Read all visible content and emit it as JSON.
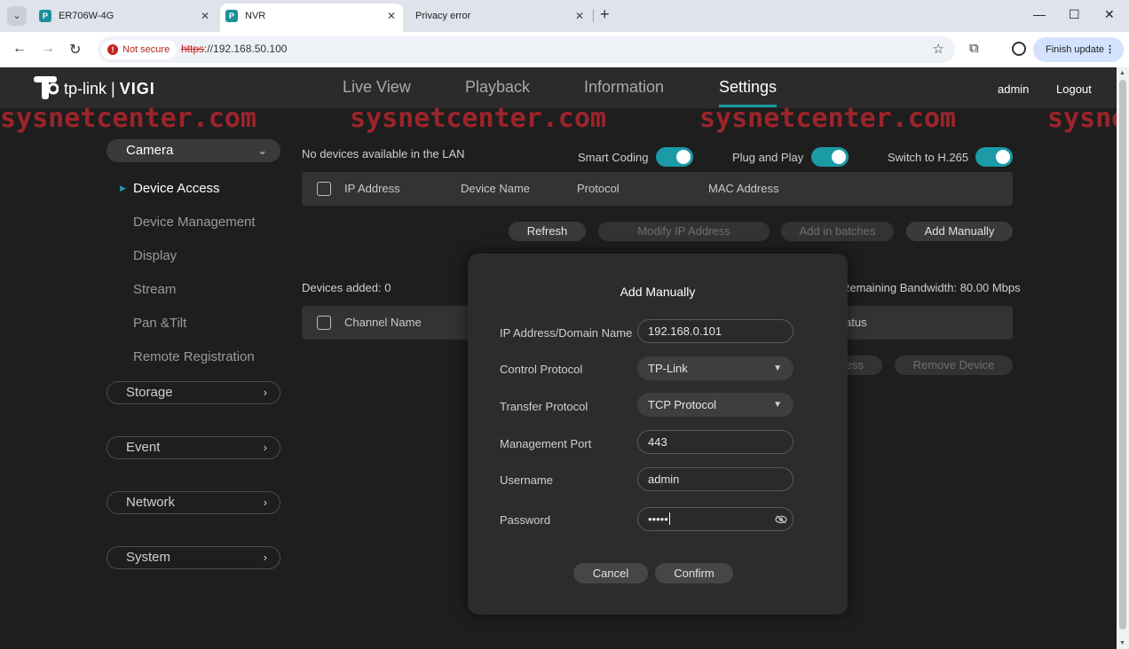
{
  "browser": {
    "tabs": [
      {
        "label": "ER706W-4G",
        "close": "✕"
      },
      {
        "label": "NVR",
        "close": "✕"
      },
      {
        "label": "Privacy error",
        "close": "✕"
      }
    ],
    "new_tab": "+",
    "not_secure": "Not secure",
    "url_scheme": "https",
    "url_rest": "://192.168.50.100",
    "finish_update": "Finish update"
  },
  "header": {
    "logo_tplink": "tp-link",
    "logo_sep": "|",
    "logo_vigi": "VIGI",
    "nav": [
      "Live View",
      "Playback",
      "Information",
      "Settings"
    ],
    "active_nav": "Settings",
    "user": "admin",
    "logout": "Logout"
  },
  "watermark": "sysnetcenter.com",
  "sidebar": {
    "camera": "Camera",
    "items": [
      "Device Access",
      "Device Management",
      "Display",
      "Stream",
      "Pan &Tilt",
      "Remote Registration"
    ],
    "groups": [
      "Storage",
      "Event",
      "Network",
      "System"
    ]
  },
  "content": {
    "lan_status": "No devices available in the LAN",
    "toggles": [
      "Smart Coding",
      "Plug and Play",
      "Switch to H.265"
    ],
    "lan_columns": [
      "IP Address",
      "Device Name",
      "Protocol",
      "MAC Address"
    ],
    "buttons": [
      "Refresh",
      "Modify IP Address",
      "Add in batches",
      "Add Manually"
    ],
    "devices_added": "Devices added: 0",
    "bandwidth": "Remaining Bandwidth: 80.00 Mbps",
    "added_columns": [
      "Channel Name",
      "atus"
    ],
    "partial_button": "ess",
    "remove_device": "Remove Device"
  },
  "modal": {
    "title": "Add Manually",
    "fields": [
      {
        "label": "IP Address/Domain Name",
        "value": "192.168.0.101"
      },
      {
        "label": "Control Protocol",
        "value": "TP-Link"
      },
      {
        "label": "Transfer Protocol",
        "value": "TCP Protocol"
      },
      {
        "label": "Management Port",
        "value": "443"
      },
      {
        "label": "Username",
        "value": "admin"
      },
      {
        "label": "Password",
        "value": "•••••"
      }
    ],
    "cancel": "Cancel",
    "confirm": "Confirm"
  },
  "colors": {
    "accent": "#1a9ba6",
    "watermark": "#b3262d",
    "background": "#1e1e1e"
  }
}
